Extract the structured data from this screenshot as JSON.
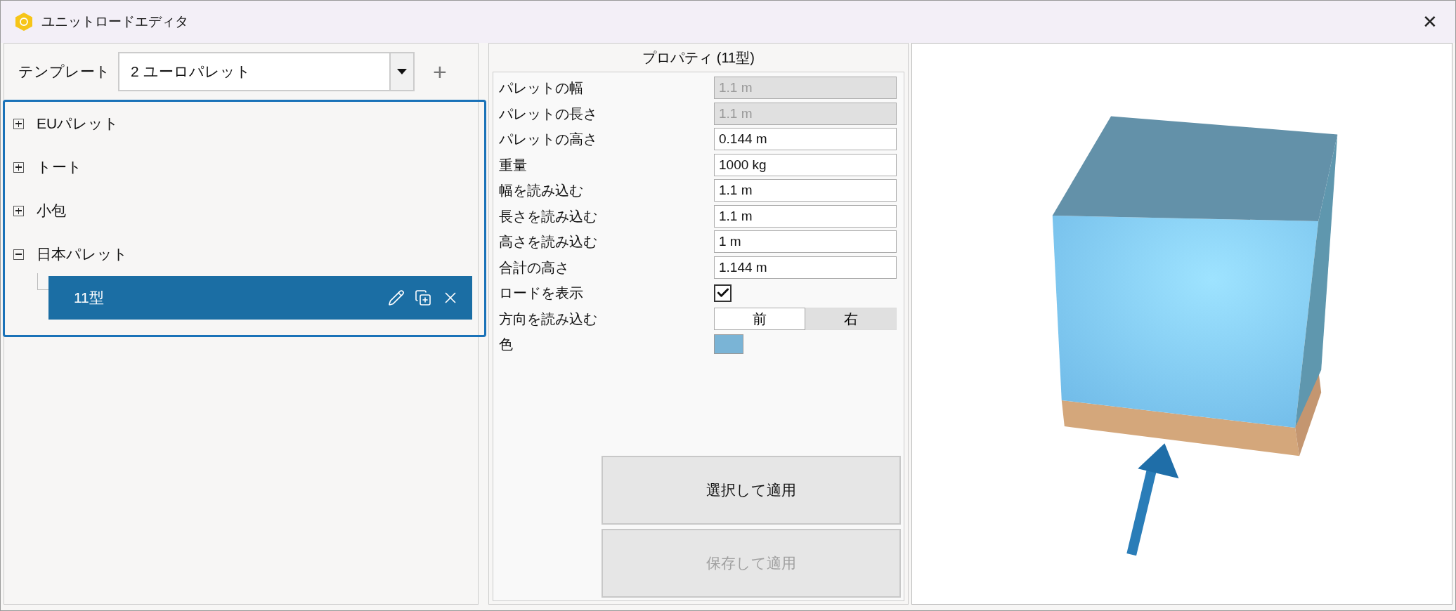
{
  "window": {
    "title": "ユニットロードエディタ",
    "close": "✕"
  },
  "template": {
    "label": "テンプレート",
    "value": "2 ユーロパレット",
    "add": "+"
  },
  "tree": [
    {
      "label": "EUパレット",
      "expanded": false
    },
    {
      "label": "トート",
      "expanded": false
    },
    {
      "label": "小包",
      "expanded": false
    },
    {
      "label": "日本パレット",
      "expanded": true,
      "children": [
        {
          "label": "11型",
          "selected": true
        }
      ]
    }
  ],
  "properties": {
    "title": "プロパティ (11型)",
    "rows": [
      {
        "kind": "field",
        "label": "パレットの幅",
        "value": "1.1 m",
        "disabled": true
      },
      {
        "kind": "field",
        "label": "パレットの長さ",
        "value": "1.1 m",
        "disabled": true
      },
      {
        "kind": "field",
        "label": "パレットの高さ",
        "value": "0.144 m",
        "disabled": false
      },
      {
        "kind": "field",
        "label": "重量",
        "value": "1000 kg",
        "disabled": false
      },
      {
        "kind": "field",
        "label": "幅を読み込む",
        "value": "1.1 m",
        "disabled": false
      },
      {
        "kind": "field",
        "label": "長さを読み込む",
        "value": "1.1 m",
        "disabled": false
      },
      {
        "kind": "field",
        "label": "高さを読み込む",
        "value": "1 m",
        "disabled": false
      },
      {
        "kind": "field",
        "label": "合計の高さ",
        "value": "1.144 m",
        "disabled": false
      },
      {
        "kind": "checkbox",
        "label": "ロードを表示",
        "checked": true
      },
      {
        "kind": "segmented",
        "label": "方向を読み込む",
        "options": [
          {
            "label": "前",
            "selected": true
          },
          {
            "label": "右",
            "selected": false
          }
        ]
      },
      {
        "kind": "color",
        "label": "色",
        "color": "#7ab4d6"
      }
    ]
  },
  "buttons": [
    {
      "label": "選択して適用",
      "disabled": false
    },
    {
      "label": "保存して適用",
      "disabled": true
    }
  ]
}
